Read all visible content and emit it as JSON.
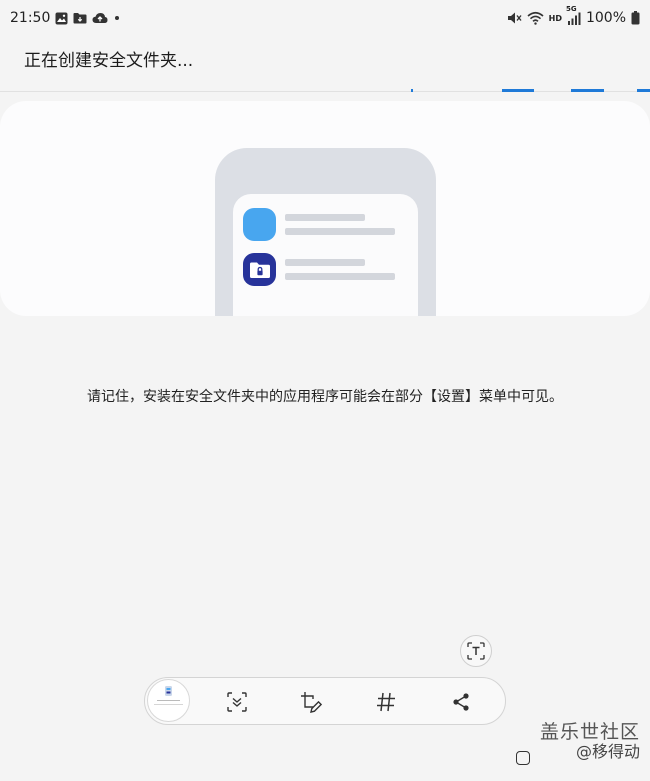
{
  "status_bar": {
    "time": "21:50",
    "left_icons": [
      "gallery-icon",
      "folder-icon",
      "cloud-upload-icon",
      "notification-dot"
    ],
    "right_icons": [
      "mute-icon",
      "wifi-icon",
      "hd-icon",
      "signal-5g-icon",
      "battery-icon"
    ],
    "hd_label": "HD",
    "network_label": "5G",
    "battery": "100%"
  },
  "header": {
    "title": "正在创建安全文件夹..."
  },
  "illustration": {
    "colors": {
      "back_panel": "#dcdfe5",
      "app_blue": "#48a6ef",
      "app_navy": "#27339a"
    }
  },
  "notice": {
    "text": "请记住，安装在安全文件夹中的应用程序可能会在部分【设置】菜单中可见。"
  },
  "screenshot_toolbar": {
    "buttons": [
      "scroll-capture-icon",
      "edit-crop-icon",
      "hashtag-icon",
      "share-icon"
    ],
    "extract_text_icon": "text-extract-icon"
  },
  "watermark": {
    "brand": "盖乐世社区",
    "handle": "@移得动"
  },
  "accent_color": "#1f7ad8"
}
